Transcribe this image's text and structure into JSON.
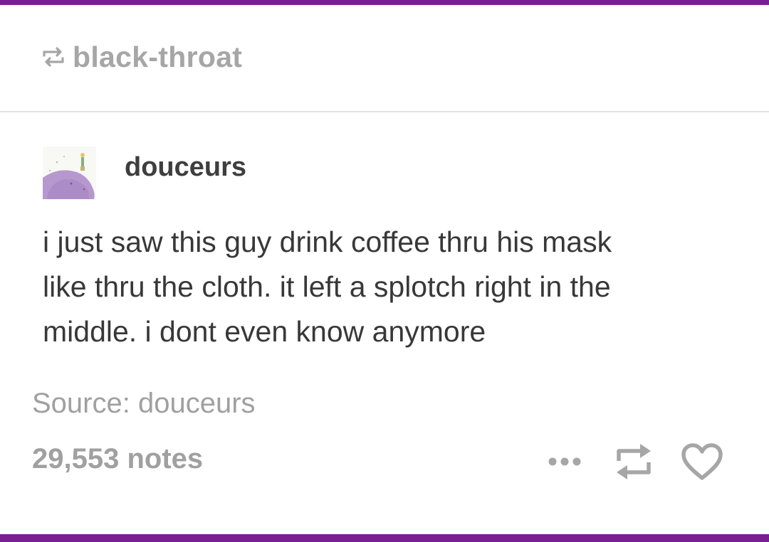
{
  "reblog": {
    "username": "black-throat",
    "icon": "reblog-icon"
  },
  "post": {
    "author": "douceurs",
    "avatar": "avatar-image-purple-planet",
    "body_lines": [
      "i just saw this guy drink coffee thru his mask",
      "like thru the cloth. it left a splotch right in the",
      "middle. i dont even know anymore"
    ]
  },
  "source": {
    "label": "Source:",
    "name": "douceurs"
  },
  "footer": {
    "notes": "29,553 notes",
    "more_icon": "more-icon",
    "reblog_icon": "reblog-icon",
    "like_icon": "heart-icon"
  },
  "colors": {
    "accent": "#7a1f93",
    "muted": "#a0a0a0",
    "text": "#383838"
  }
}
